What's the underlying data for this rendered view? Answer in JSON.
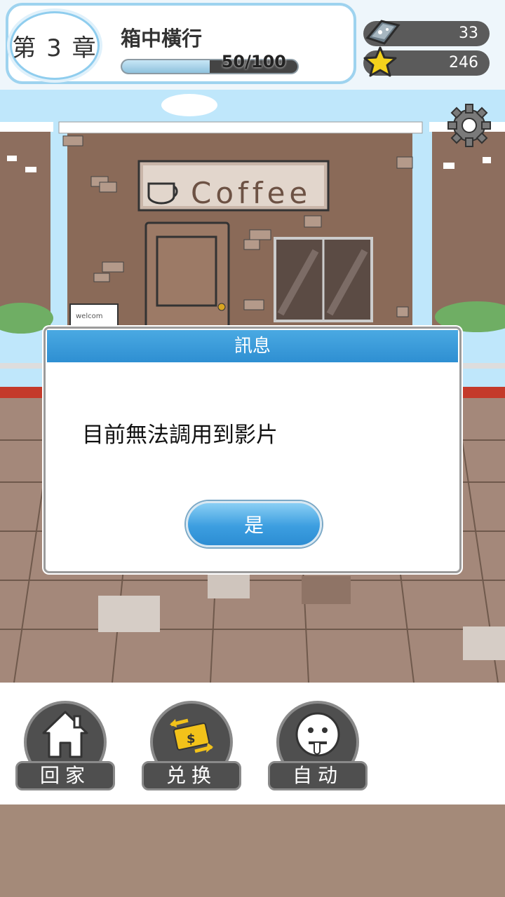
{
  "header": {
    "chapter_label": "第 3 章",
    "stage_title": "箱中橫行",
    "progress_text": "50/100",
    "progress_fraction": 0.5
  },
  "currencies": {
    "gem_count": "33",
    "star_count": "246"
  },
  "scene": {
    "shop_sign": "Coffee",
    "welcome_sign": "welcom"
  },
  "dialog": {
    "title": "訊息",
    "message": "目前無法調用到影片",
    "confirm_label": "是"
  },
  "nav": {
    "home_label": "回家",
    "exchange_label": "兑换",
    "auto_label": "自动"
  },
  "icons": {
    "settings": "gear-icon",
    "gem": "gem-icon",
    "star": "star-icon",
    "home": "house-icon",
    "exchange": "money-exchange-icon",
    "auto": "face-icon"
  },
  "colors": {
    "accent": "#2e8fd2",
    "header_border": "#9ed3ef",
    "nav_button": "#4f4f4f",
    "star": "#f4d21c"
  }
}
